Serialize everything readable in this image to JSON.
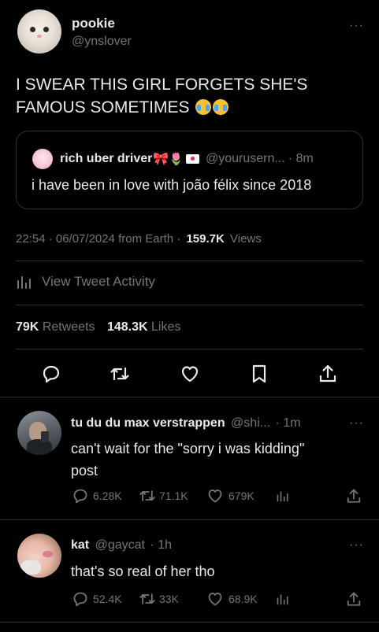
{
  "author": {
    "display_name": "pookie",
    "handle": "@ynslover"
  },
  "tweet": {
    "text_line1": "I SWEAR THIS GIRL FORGETS SHE'S",
    "text_line2": "FAMOUS SOMETIMES",
    "emoji": "loudly-crying-face-emoji"
  },
  "quote": {
    "display_name": "rich uber driver",
    "handle": "@yourusern...",
    "time": "· 8m",
    "text": "i have been in love with joão félix since 2018"
  },
  "meta": {
    "timestamp": "22:54 · 06/07/2024 from Earth ·",
    "views_count": "159.7K",
    "views_label": "Views"
  },
  "activity": {
    "label": "View Tweet Activity"
  },
  "stats": {
    "retweets_count": "79K",
    "retweets_label": "Retweets",
    "likes_count": "148.3K",
    "likes_label": "Likes"
  },
  "replies": [
    {
      "display_name": "tu du du max verstrappen",
      "handle": "@shi...",
      "time": "· 1m",
      "text_line1": "can't wait for the \"sorry i was kidding\"",
      "text_line2": "post",
      "replies": "6.28K",
      "retweets": "71.1K",
      "likes": "679K"
    },
    {
      "display_name": "kat",
      "handle": "@gaycat",
      "time": "· 1h",
      "text_line1": "that's so real of her tho",
      "replies": "52.4K",
      "retweets": "33K",
      "likes": "68.9K"
    }
  ],
  "colors": {
    "background": "#000000",
    "text": "#e7e9ea",
    "secondary": "#71767b",
    "border": "#2f3336"
  }
}
